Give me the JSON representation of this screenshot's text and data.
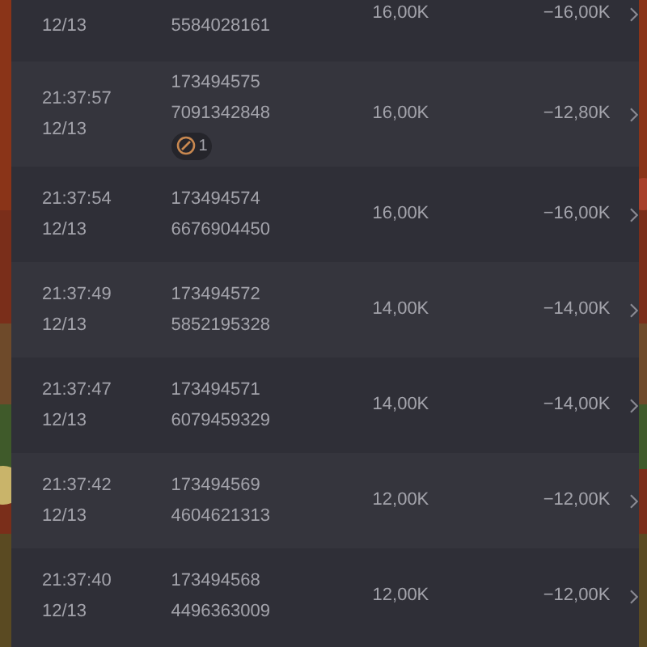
{
  "rows": [
    {
      "date": "12/13",
      "id_line_2": "5584028161",
      "amount": "16,00K",
      "net": "−16,00K"
    },
    {
      "time": "21:37:57",
      "date": "12/13",
      "id_line_1": "173494575",
      "id_line_2": "7091342848",
      "badge": "1",
      "amount": "16,00K",
      "net": "−12,80K"
    },
    {
      "time": "21:37:54",
      "date": "12/13",
      "id_line_1": "173494574",
      "id_line_2": "6676904450",
      "amount": "16,00K",
      "net": "−16,00K"
    },
    {
      "time": "21:37:49",
      "date": "12/13",
      "id_line_1": "173494572",
      "id_line_2": "5852195328",
      "amount": "14,00K",
      "net": "−14,00K"
    },
    {
      "time": "21:37:47",
      "date": "12/13",
      "id_line_1": "173494571",
      "id_line_2": "6079459329",
      "amount": "14,00K",
      "net": "−14,00K"
    },
    {
      "time": "21:37:42",
      "date": "12/13",
      "id_line_1": "173494569",
      "id_line_2": "4604621313",
      "amount": "12,00K",
      "net": "−12,00K"
    },
    {
      "time": "21:37:40",
      "date": "12/13",
      "id_line_1": "173494568",
      "id_line_2": "4496363009",
      "amount": "12,00K",
      "net": "−12,00K"
    }
  ]
}
